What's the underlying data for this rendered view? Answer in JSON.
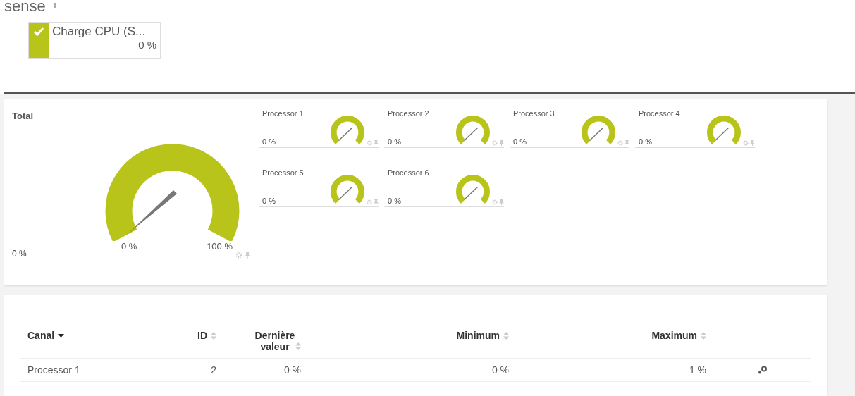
{
  "header": {
    "title": "sense"
  },
  "sensor_tile": {
    "name": "Charge CPU (S...",
    "value": "0 %",
    "checked": true
  },
  "total_gauge": {
    "title": "Total",
    "value": "0 %",
    "min_label": "0 %",
    "max_label": "100 %"
  },
  "processor_gauges": [
    {
      "title": "Processor 1",
      "value": "0 %"
    },
    {
      "title": "Processor 2",
      "value": "0 %"
    },
    {
      "title": "Processor 3",
      "value": "0 %"
    },
    {
      "title": "Processor 4",
      "value": "0 %"
    },
    {
      "title": "Processor 5",
      "value": "0 %"
    },
    {
      "title": "Processor 6",
      "value": "0 %"
    }
  ],
  "table": {
    "columns": [
      {
        "label": "Canal",
        "sorted": true
      },
      {
        "label": "ID",
        "sorted": false
      },
      {
        "label": "Dernière valeur",
        "sorted": false
      },
      {
        "label": "Minimum",
        "sorted": false
      },
      {
        "label": "Maximum",
        "sorted": false
      }
    ],
    "rows": [
      {
        "cells": [
          "Processor 1",
          "2",
          "0 %",
          "0 %",
          "1 %"
        ]
      }
    ]
  }
}
